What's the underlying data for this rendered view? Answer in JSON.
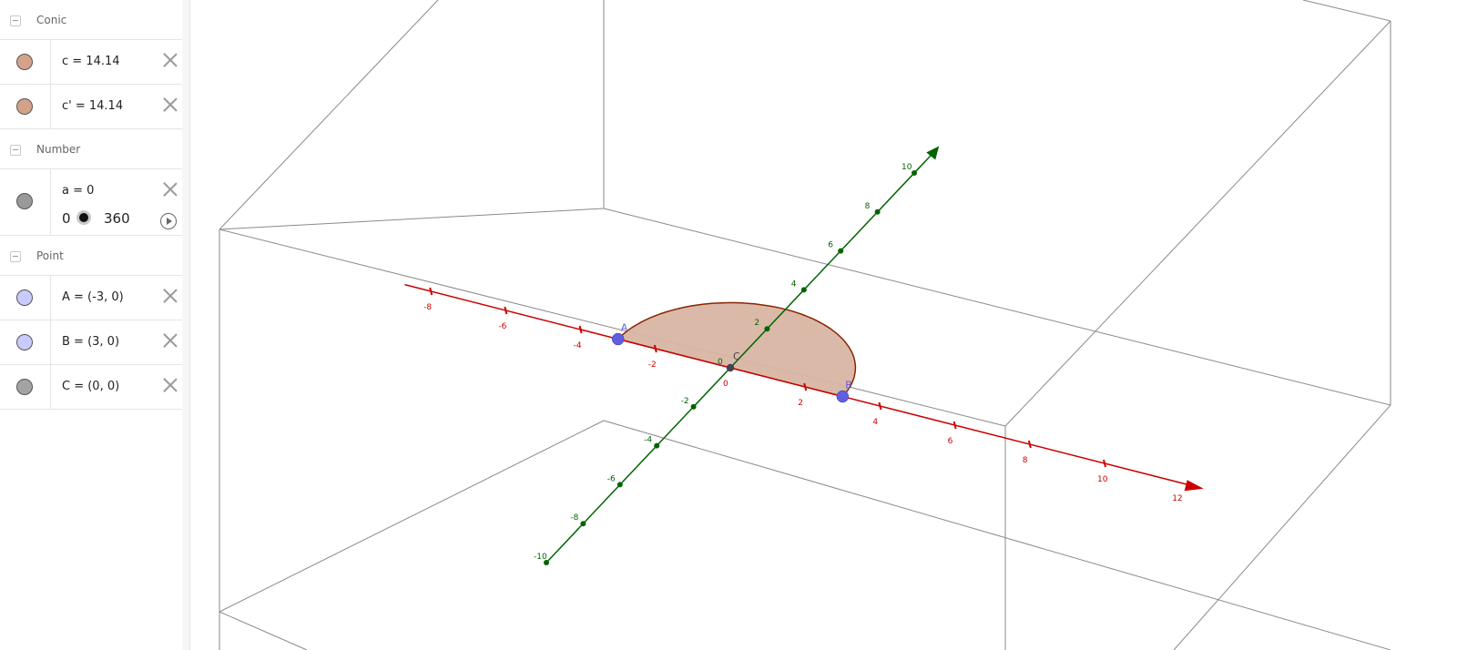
{
  "algebra": {
    "groups": [
      {
        "label": "Conic",
        "items": [
          {
            "definition": "c = 14.14",
            "color": "#d4a289"
          },
          {
            "definition": "c' = 14.14",
            "color": "#d4a289"
          }
        ]
      },
      {
        "label": "Number",
        "items": [
          {
            "definition": "a = 0",
            "color": "#999999",
            "slider": {
              "min": "0",
              "max": "360",
              "value": 0
            }
          }
        ]
      },
      {
        "label": "Point",
        "items": [
          {
            "definition": "A = (-3, 0)",
            "color": "#c9cbff"
          },
          {
            "definition": "B = (3, 0)",
            "color": "#c9cbff"
          },
          {
            "definition": "C = (0, 0)",
            "color": "#a3a3a3"
          }
        ]
      }
    ]
  },
  "graphics": {
    "x_axis": {
      "color": "#cc0000",
      "ticks": [
        "-8",
        "-6",
        "-4",
        "-2",
        "0",
        "2",
        "4",
        "6",
        "8",
        "10",
        "12"
      ],
      "arrow": true
    },
    "y_axis": {
      "color": "#006400",
      "ticks": [
        "-10",
        "-8",
        "-6",
        "-4",
        "-2",
        "0",
        "2",
        "4",
        "6",
        "8",
        "10"
      ],
      "arrow": true
    },
    "points": [
      {
        "name": "A",
        "label": "A",
        "color": "#5f5fe0"
      },
      {
        "name": "B",
        "label": "B",
        "color": "#5f5fe0"
      },
      {
        "name": "C",
        "label": "C",
        "color": "#444444"
      }
    ],
    "semi_ellipse": {
      "fill": "#d9b5a3",
      "stroke": "#8b2500"
    }
  }
}
